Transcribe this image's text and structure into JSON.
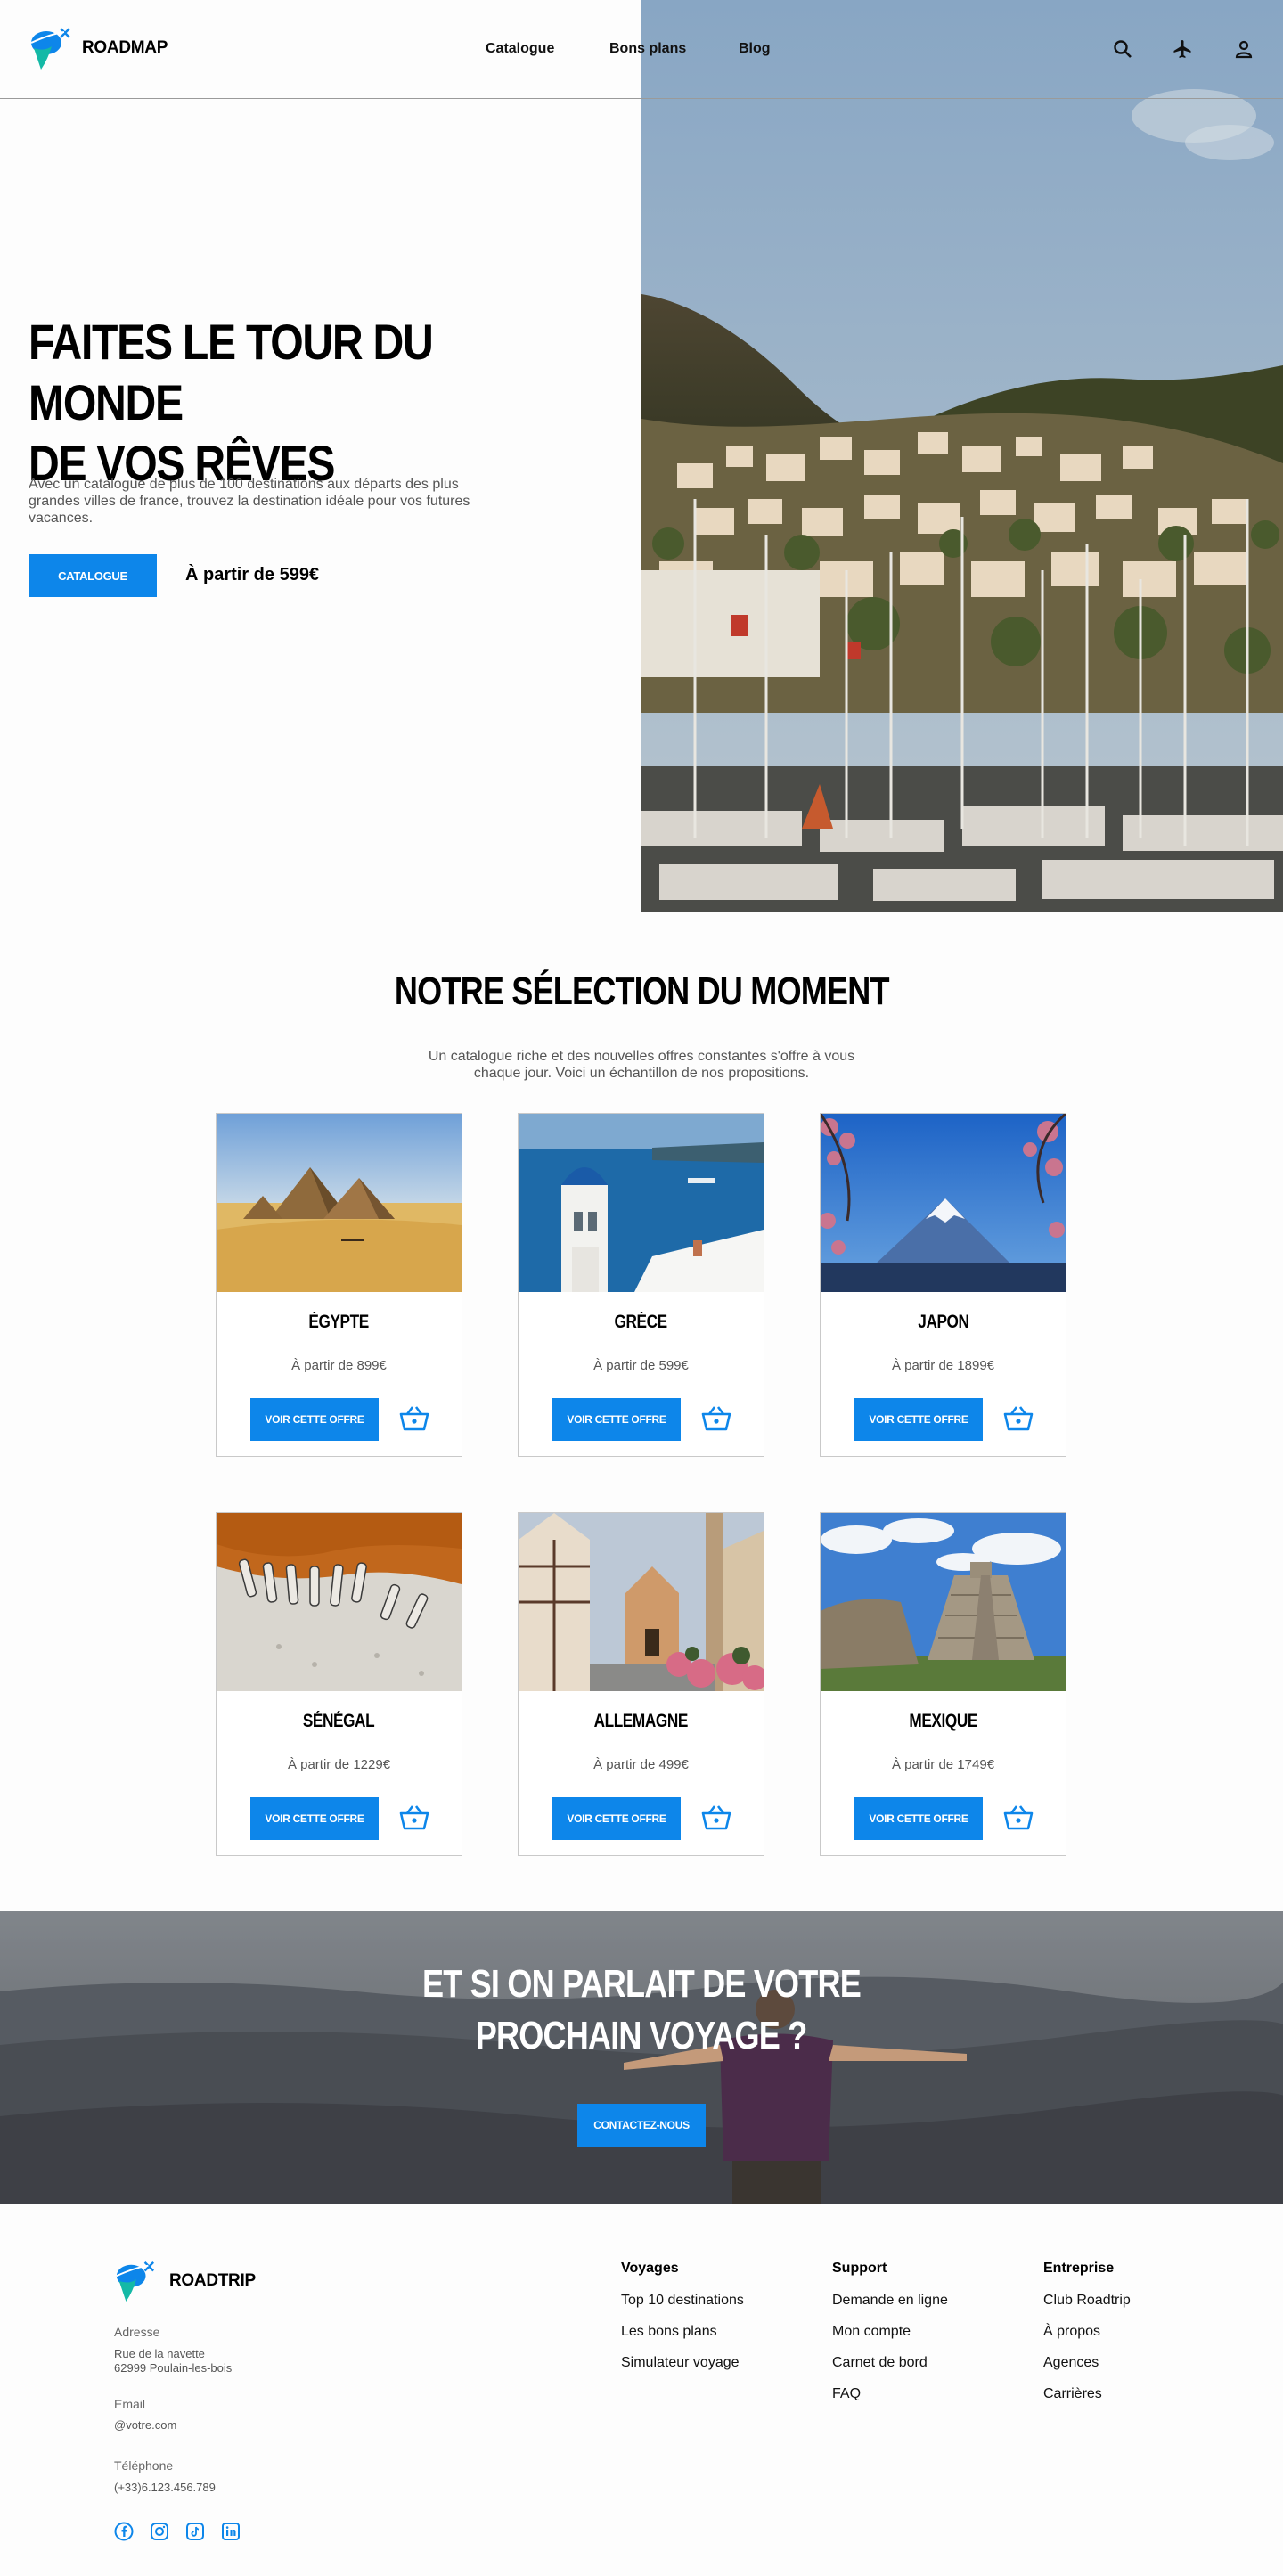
{
  "header": {
    "logo_text": "ROADMAP",
    "nav": [
      "Catalogue",
      "Bons plans",
      "Blog"
    ],
    "icons": [
      "search-icon",
      "plane-icon",
      "user-icon"
    ]
  },
  "hero": {
    "title_line1": "FAITES LE TOUR DU MONDE",
    "title_line2": "DE VOS RÊVES",
    "description": "Avec un catalogue de plus de 100 destinations aux départs des plus grandes villes de france, trouvez la destination idéale pour vos futures vacances.",
    "button": "CATALOGUE",
    "price": "À partir de 599€"
  },
  "selection": {
    "title": "NOTRE SÉLECTION DU MOMENT",
    "description": "Un catalogue riche et des nouvelles offres constantes s'offre à vous chaque jour. Voici un échantillon de nos propositions.",
    "cards": [
      {
        "name": "ÉGYPTE",
        "price": "À partir de 899€",
        "button": "VOIR CETTE OFFRE"
      },
      {
        "name": "GRÈCE",
        "price": "À partir de 599€",
        "button": "VOIR CETTE OFFRE"
      },
      {
        "name": "JAPON",
        "price": "À partir de 1899€",
        "button": "VOIR CETTE OFFRE"
      },
      {
        "name": "SÉNÉGAL",
        "price": "À partir de 1229€",
        "button": "VOIR CETTE OFFRE"
      },
      {
        "name": "ALLEMAGNE",
        "price": "À partir de 499€",
        "button": "VOIR CETTE OFFRE"
      },
      {
        "name": "MEXIQUE",
        "price": "À partir de 1749€",
        "button": "VOIR CETTE OFFRE"
      }
    ]
  },
  "cta": {
    "title_line1": "ET SI ON PARLAIT DE VOTRE",
    "title_line2": "PROCHAIN VOYAGE ?",
    "button": "CONTACTEZ-NOUS"
  },
  "footer": {
    "logo_text": "ROADTRIP",
    "address_label": "Adresse",
    "address_line1": "Rue de la navette",
    "address_line2": "62999 Poulain-les-bois",
    "email_label": "Email",
    "email_value": "@votre.com",
    "phone_label": "Téléphone",
    "phone_value": "(+33)6.123.456.789",
    "columns": [
      {
        "title": "Voyages",
        "links": [
          "Top 10 destinations",
          "Les bons plans",
          "Simulateur voyage"
        ]
      },
      {
        "title": "Support",
        "links": [
          "Demande en ligne",
          "Mon compte",
          "Carnet de bord",
          "FAQ"
        ]
      },
      {
        "title": "Entreprise",
        "links": [
          "Club Roadtrip",
          "À propos",
          "Agences",
          "Carrières"
        ]
      }
    ],
    "socials": [
      "facebook-icon",
      "instagram-icon",
      "tiktok-icon",
      "linkedin-icon"
    ]
  },
  "colors": {
    "accent": "#0d86ea",
    "text": "#000000",
    "muted": "#555555"
  }
}
